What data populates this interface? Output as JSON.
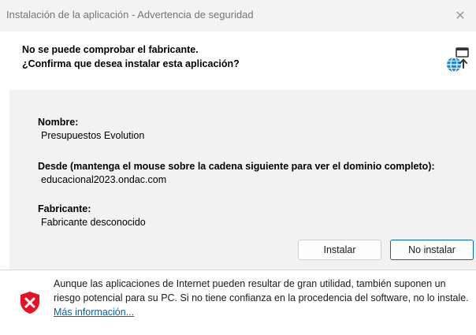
{
  "window": {
    "title": "Instalación de la aplicación - Advertencia de seguridad",
    "close_glyph": "✕"
  },
  "header": {
    "line1": "No se puede comprobar el fabricante.",
    "line2": "¿Confirma que desea instalar esta aplicación?",
    "icon": "globe-install-icon"
  },
  "details": {
    "name_label": "Nombre:",
    "name_value": "Presupuestos  Evolution",
    "from_label": "Desde (mantenga el mouse sobre la cadena siguiente para ver el dominio completo):",
    "from_value": "educacional2023.ondac.com",
    "publisher_label": "Fabricante:",
    "publisher_value": "Fabricante desconocido"
  },
  "buttons": {
    "install": "Instalar",
    "dont_install": "No instalar"
  },
  "footer": {
    "warning_text": "Aunque las aplicaciones de Internet pueden resultar de gran utilidad, también suponen un riesgo potencial para su PC. Si no tiene confianza en la procedencia del software, no lo instale.",
    "more_info_link": "Más información...",
    "icon": "shield-warning-icon"
  },
  "colors": {
    "accent": "#0067c0",
    "link": "#0063b1",
    "shield_red": "#e81123"
  }
}
